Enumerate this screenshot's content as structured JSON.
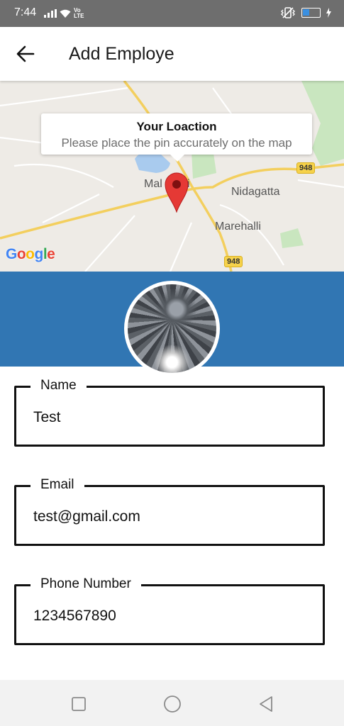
{
  "status_bar": {
    "time": "7:44",
    "network_tag_top": "Vo",
    "network_tag_bottom": "LTE",
    "battery_level_percent": 40,
    "icons": [
      "signal-icon",
      "wifi-icon",
      "volte-icon",
      "vibrate-icon",
      "battery-icon"
    ]
  },
  "app_bar": {
    "title": "Add Employe",
    "back_icon": "arrow-left-icon"
  },
  "map": {
    "tooltip_title": "Your Loaction",
    "tooltip_subtitle": "Please place the pin accurately on the map",
    "places": {
      "town_left": "Mal",
      "town_left_tail": "i",
      "nidagatta": "Nidagatta",
      "marehalli": "Marehalli"
    },
    "shields": {
      "right": "948",
      "bottom": "948"
    },
    "attribution": [
      "G",
      "o",
      "o",
      "g",
      "l",
      "e"
    ],
    "colors": {
      "pin": "#e53935",
      "road": "#f7d766",
      "water": "#a9cbee",
      "park": "#c8e6c0"
    }
  },
  "profile": {
    "banner_color": "#3176b3",
    "avatar_icon": "avatar-photo"
  },
  "form": {
    "fields": [
      {
        "label": "Name",
        "value": "Test"
      },
      {
        "label": "Email",
        "value": "test@gmail.com"
      },
      {
        "label": "Phone Number",
        "value": "1234567890"
      }
    ]
  },
  "nav_bar": {
    "icons": [
      "square-recents-icon",
      "circle-home-icon",
      "triangle-back-icon"
    ]
  }
}
